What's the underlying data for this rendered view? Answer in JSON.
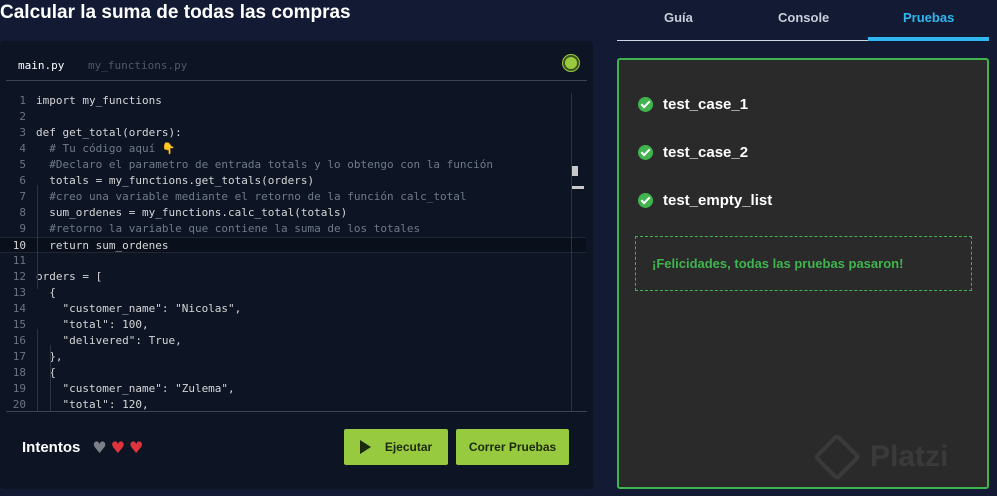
{
  "page_title": "Calcular la suma de todas las compras",
  "editor": {
    "tabs": [
      {
        "label": "main.py",
        "active": true
      },
      {
        "label": "my_functions.py",
        "active": false
      }
    ],
    "current_line": 10,
    "lines": [
      {
        "n": "1",
        "text": "import my_functions"
      },
      {
        "n": "2",
        "text": ""
      },
      {
        "n": "3",
        "text": "def get_total(orders):"
      },
      {
        "n": "4",
        "text": "  # Tu código aquí 👇"
      },
      {
        "n": "5",
        "text": "  #Declaro el parametro de entrada totals y lo obtengo con la función"
      },
      {
        "n": "6",
        "text": "  totals = my_functions.get_totals(orders)"
      },
      {
        "n": "7",
        "text": "  #creo una variable mediante el retorno de la función calc_total"
      },
      {
        "n": "8",
        "text": "  sum_ordenes = my_functions.calc_total(totals)"
      },
      {
        "n": "9",
        "text": "  #retorno la variable que contiene la suma de los totales"
      },
      {
        "n": "10",
        "text": "  return sum_ordenes"
      },
      {
        "n": "11",
        "text": ""
      },
      {
        "n": "12",
        "text": "orders = ["
      },
      {
        "n": "13",
        "text": "  {"
      },
      {
        "n": "14",
        "text": "    \"customer_name\": \"Nicolas\","
      },
      {
        "n": "15",
        "text": "    \"total\": 100,"
      },
      {
        "n": "16",
        "text": "    \"delivered\": True,"
      },
      {
        "n": "17",
        "text": "  },"
      },
      {
        "n": "18",
        "text": "  {"
      },
      {
        "n": "19",
        "text": "    \"customer_name\": \"Zulema\","
      },
      {
        "n": "20",
        "text": "    \"total\": 120,"
      }
    ]
  },
  "footer": {
    "attempts_label": "Intentos",
    "hearts": [
      "gray",
      "red",
      "red"
    ],
    "run_label": "Ejecutar",
    "test_label": "Correr Pruebas"
  },
  "right_tabs": [
    {
      "label": "Guía"
    },
    {
      "label": "Console"
    },
    {
      "label": "Pruebas",
      "active": true
    }
  ],
  "tests": [
    {
      "name": "test_case_1",
      "status": "passed"
    },
    {
      "name": "test_case_2",
      "status": "passed"
    },
    {
      "name": "test_empty_list",
      "status": "passed"
    }
  ],
  "success_message": "¡Felicidades, todas las pruebas pasaron!",
  "watermark": "Platzi",
  "colors": {
    "accent_green": "#98ca3f",
    "pass_green": "#3fb44f",
    "tab_blue": "#2eb7f0",
    "heart_red": "#e0343c",
    "heart_gray": "#7a7f88"
  }
}
